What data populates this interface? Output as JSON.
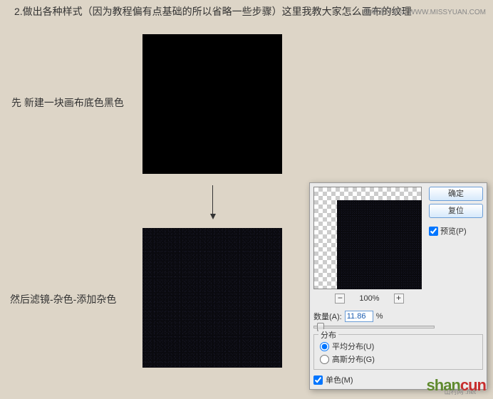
{
  "header": "2.做出各种样式（因为教程偏有点基础的所以省略一些步骤）这里我教大家怎么画布的纹理",
  "watermark_top": "思缘设计论坛 WWW.MISSYUAN.COM",
  "step1": {
    "label": "先 新建一块画布底色黑色"
  },
  "step2": {
    "label": "然后滤镜-杂色-添加杂色"
  },
  "dialog": {
    "ok": "确定",
    "cancel": "复位",
    "preview_label": "预览(P)",
    "zoom_percent": "100%",
    "amount_label": "数量(A):",
    "amount_value": "11.86",
    "amount_unit": "%",
    "distribution": {
      "title": "分布",
      "uniform": "平均分布(U)",
      "gaussian": "高斯分布(G)"
    },
    "monochrome": "单色(M)"
  },
  "logo": {
    "brand1": "shan",
    "brand2": "cun",
    "sub": "山村网 .net"
  }
}
